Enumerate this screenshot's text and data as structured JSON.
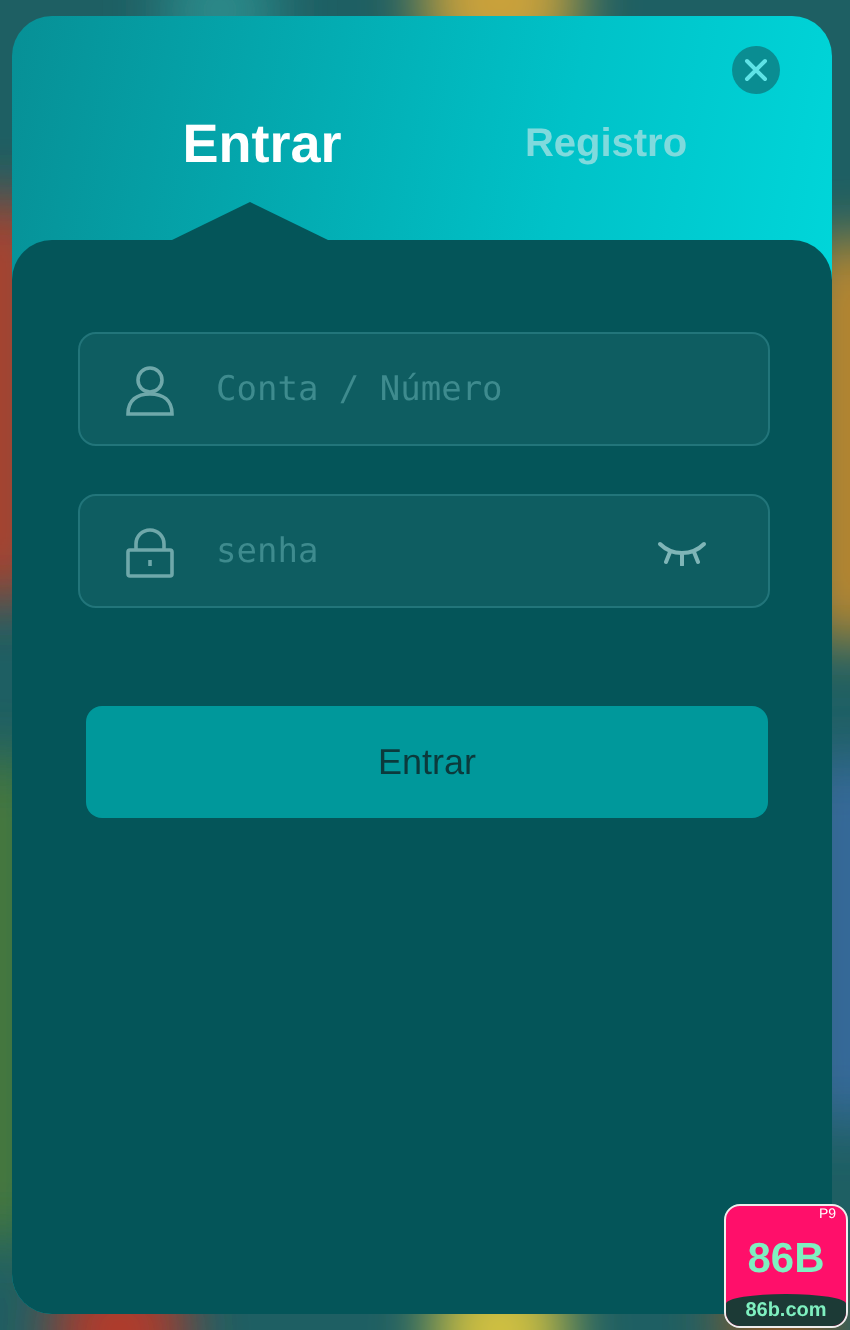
{
  "tabs": [
    {
      "label": "Entrar",
      "selected": true
    },
    {
      "label": "Registro",
      "selected": false
    }
  ],
  "fields": [
    {
      "kind": "account",
      "placeholder": "Conta / Número"
    },
    {
      "kind": "password",
      "placeholder": "senha",
      "password_visible": false
    }
  ],
  "submit_button": {
    "label": "Entrar"
  },
  "site_badge": {
    "corner_text": "P9",
    "title": "86B",
    "url": "86b.com"
  }
}
